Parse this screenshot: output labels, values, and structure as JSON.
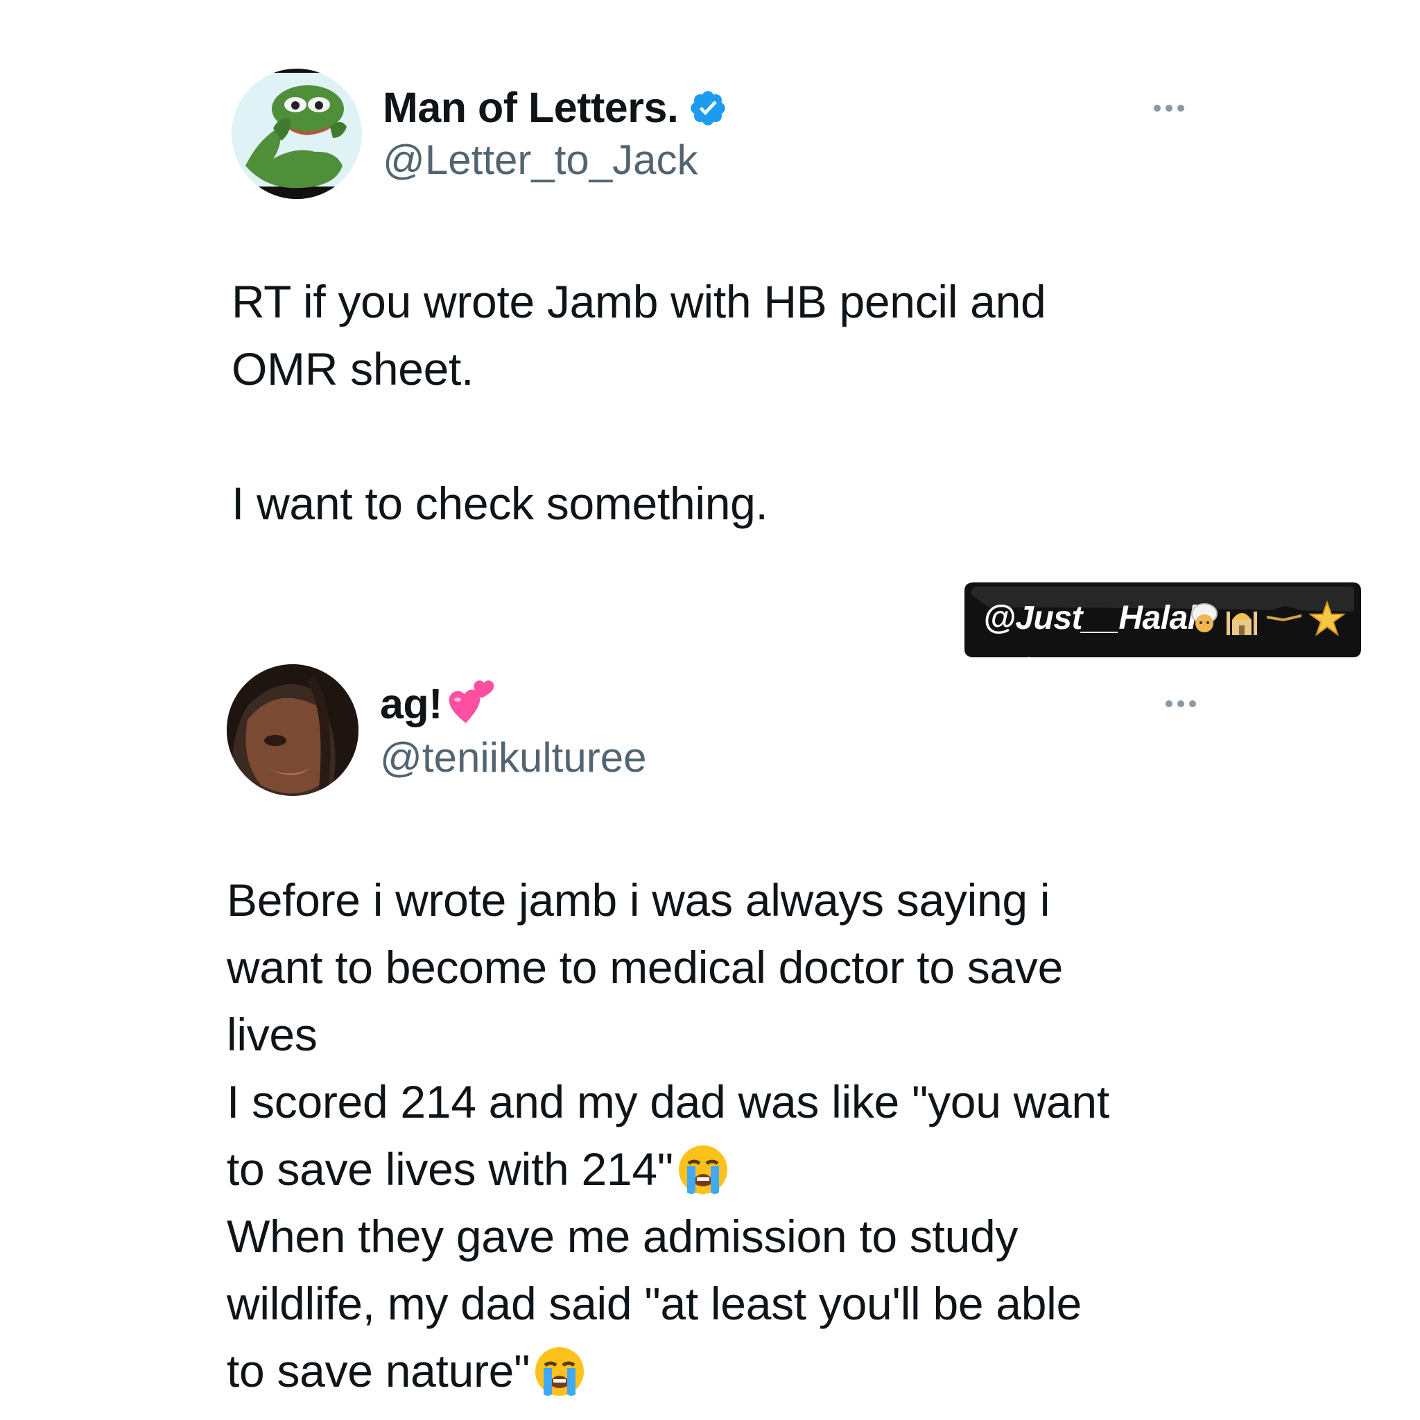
{
  "tweets": [
    {
      "display_name": "Man of Letters.",
      "handle": "@Letter_to_Jack",
      "verified": true,
      "text_lines": [
        "RT if you wrote Jamb with HB pencil and",
        "OMR sheet.",
        "",
        "I want to check something."
      ]
    },
    {
      "display_name": "ag!",
      "name_emoji": "two-hearts",
      "handle": "@teniikulturee",
      "text_lines": [
        "Before i wrote jamb i was always saying i",
        "want to become to medical doctor to save",
        "lives",
        "I scored 214 and my dad was like \"you want",
        "to save lives with 214\"",
        "When they gave me admission to study",
        "wildlife, my dad said \"at least you'll be able",
        "to save nature\""
      ],
      "line_emojis": {
        "4": "loudly-crying-face",
        "7": "loudly-crying-face"
      }
    }
  ],
  "watermark": {
    "text": "@Just__Halal",
    "emojis": [
      "man-with-turban",
      "mosque",
      "kaaba",
      "star"
    ]
  },
  "colors": {
    "text": "#0f1419",
    "secondary": "#536471",
    "verified": "#1d9bf0",
    "more_dots": "#8b98a5",
    "watermark_bg": "#111111"
  }
}
